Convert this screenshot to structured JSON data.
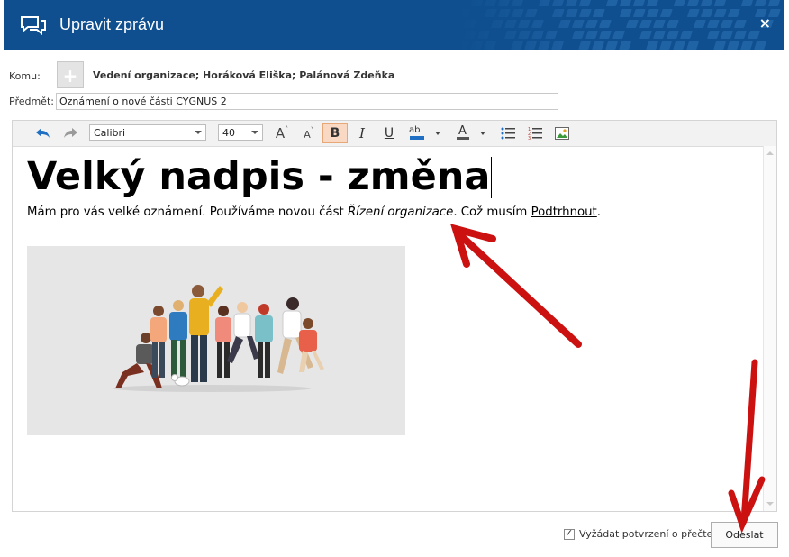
{
  "window": {
    "title": "Upravit zprávu",
    "close_icon": "close-icon",
    "close_glyph": "×"
  },
  "form": {
    "to_label": "Komu:",
    "add_glyph": "+",
    "recipients": "Vedení organizace; Horáková Eliška; Palánová Zdeňka",
    "subject_label": "Předmět:",
    "subject_value": "Oznámení o nové části CYGNUS 2"
  },
  "toolbar": {
    "font_family": "Calibri",
    "font_size": "40",
    "bold": "B",
    "italic": "I",
    "underline": "U",
    "grow_font": "A",
    "shrink_font": "A",
    "highlight_label": "ab",
    "font_color_label": "A"
  },
  "editor": {
    "heading": "Velký nadpis - změna",
    "para_start": "Mám pro vás velké oznámení. Používáme novou část ",
    "para_italic": "Řízení organizace",
    "para_mid": ". Což musím ",
    "para_underline": "Podtrhnout",
    "para_end": "."
  },
  "footer": {
    "checkbox_checked": true,
    "check_glyph": "✓",
    "confirm_label": "Vyžádat potvrzení o přečtení",
    "send_label": "Odeslat"
  },
  "colors": {
    "title_bar": "#0f4f8f",
    "bold_active": "#f9d9c3",
    "annotation_arrow": "#cc1111"
  }
}
